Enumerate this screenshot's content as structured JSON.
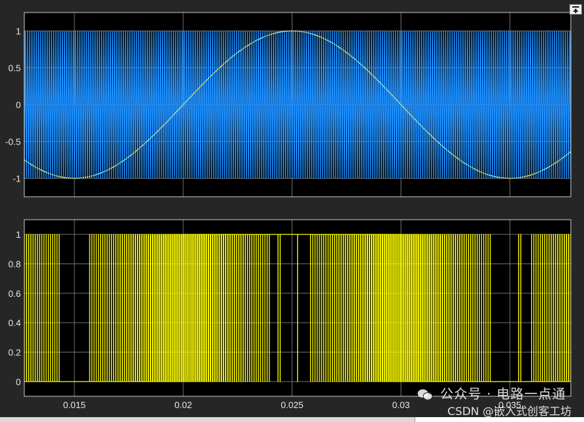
{
  "toolbar": {
    "restore_icon": "restore-layout-icon"
  },
  "watermark": {
    "line1": "公众号 · 电路一点通",
    "line2": "CSDN @嵌入式创客工坊",
    "icon": "wechat-icon"
  },
  "colors": {
    "background": "#262626",
    "axes_bg": "#000000",
    "axes_border": "#c8c8c8",
    "grid": "#6e6e6e",
    "tick_text": "#e8e8e8",
    "carrier": "#1e90ff",
    "reference": "#d8f0a0",
    "pwm": "#ffff00"
  },
  "chart_data": [
    {
      "type": "line",
      "title": "",
      "xlabel": "",
      "ylabel": "",
      "xlim": [
        0.0127,
        0.0378
      ],
      "ylim": [
        -1.25,
        1.25
      ],
      "yticks": [
        "1",
        "0.5",
        "0",
        "-0.5",
        "-1"
      ],
      "yticks_values": [
        1,
        0.5,
        0,
        -0.5,
        -1
      ],
      "xtick_values": [
        0.015,
        0.02,
        0.025,
        0.03,
        0.035
      ],
      "grid": true,
      "series": [
        {
          "role": "carrier",
          "kind": "triangle",
          "frequency_hz": 10000,
          "amplitude": 1
        },
        {
          "role": "reference",
          "kind": "sine",
          "frequency_hz": 50,
          "amplitude": 1,
          "peak_at": 0.025
        }
      ]
    },
    {
      "type": "line",
      "title": "",
      "xlabel": "",
      "ylabel": "",
      "xlim": [
        0.0127,
        0.0378
      ],
      "ylim": [
        -0.1,
        1.1
      ],
      "yticks": [
        "1",
        "0.8",
        "0.6",
        "0.4",
        "0.2",
        "0"
      ],
      "yticks_values": [
        1,
        0.8,
        0.6,
        0.4,
        0.2,
        0
      ],
      "xticks": [
        "0.015",
        "0.02",
        "0.025",
        "0.03",
        "0.035"
      ],
      "xticks_values": [
        0.015,
        0.02,
        0.025,
        0.03,
        0.035
      ],
      "grid": true,
      "series": [
        {
          "role": "pwm",
          "kind": "pulse",
          "from": "compare(reference, carrier)",
          "low": 0,
          "high": 1
        }
      ]
    }
  ]
}
